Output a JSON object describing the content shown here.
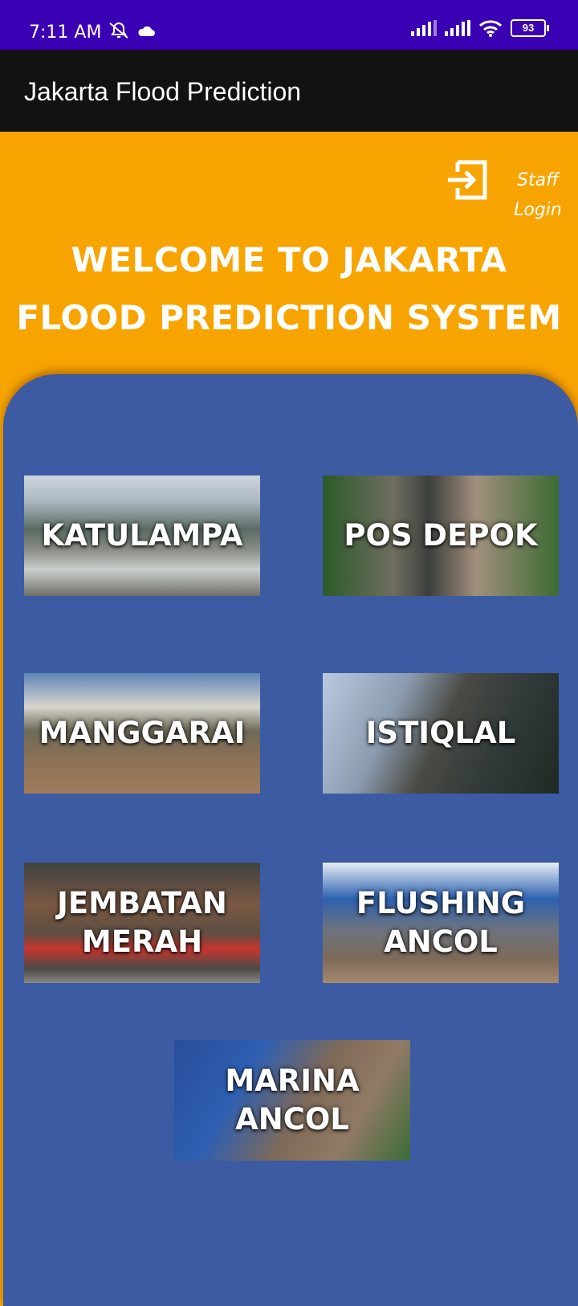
{
  "status_bar": {
    "time": "7:11 AM",
    "battery": "93",
    "icons": [
      "mute-icon",
      "cloud-icon",
      "signal-icon",
      "signal-icon",
      "wifi-icon",
      "battery-icon"
    ]
  },
  "app_bar": {
    "title": "Jakarta Flood Prediction"
  },
  "header": {
    "login_icon": "login-icon",
    "staff_login_label": "Staff Login",
    "welcome_text": "WELCOME TO JAKARTA FLOOD PREDICTION SYSTEM"
  },
  "stations": [
    {
      "label": "KATULAMPA"
    },
    {
      "label": "POS DEPOK"
    },
    {
      "label": "MANGGARAI"
    },
    {
      "label": "ISTIQLAL"
    },
    {
      "label": "JEMBATAN MERAH"
    },
    {
      "label": "FLUSHING ANCOL"
    },
    {
      "label": "MARINA ANCOL"
    }
  ],
  "colors": {
    "status_bar": "#3a00b4",
    "app_bar": "#121212",
    "header_bg": "#f7a400",
    "panel_bg": "#3c5ba2"
  }
}
